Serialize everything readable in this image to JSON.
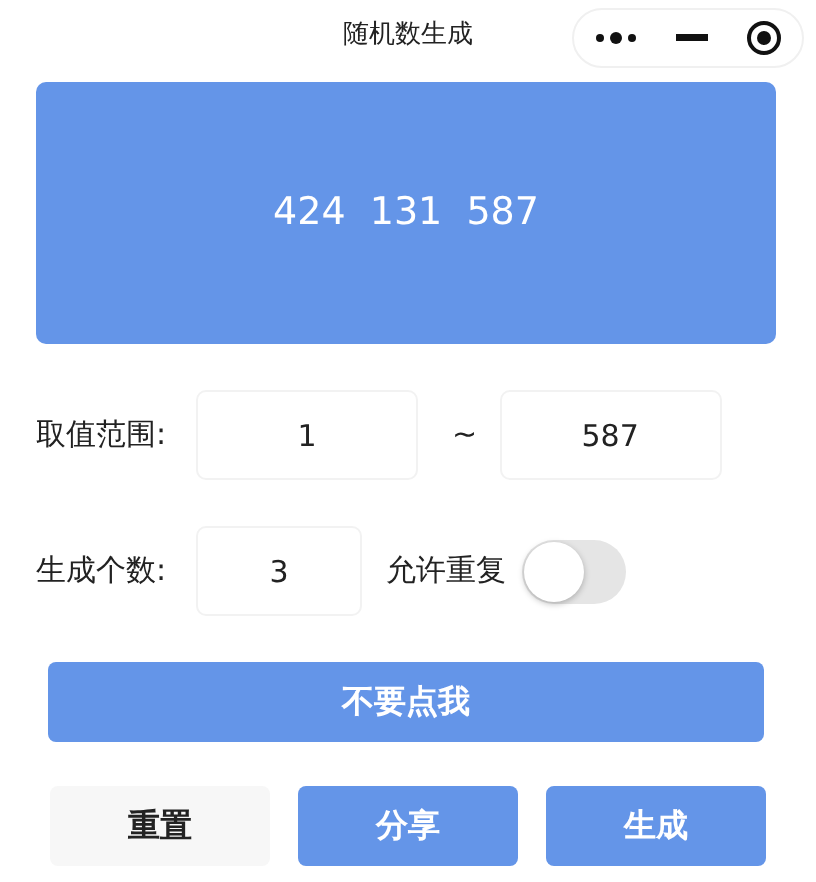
{
  "window": {
    "title": "随机数生成"
  },
  "result": {
    "text": "424  131  587"
  },
  "range": {
    "label": "取值范围:",
    "min": "1",
    "separator": "~",
    "max": "587"
  },
  "count": {
    "label": "生成个数:",
    "value": "3",
    "repeat_label": "允许重复",
    "repeat_on": false
  },
  "warning_button": "不要点我",
  "buttons": [
    {
      "label": "重置",
      "kind": "plain"
    },
    {
      "label": "分享",
      "kind": "primary"
    },
    {
      "label": "生成",
      "kind": "primary"
    }
  ]
}
